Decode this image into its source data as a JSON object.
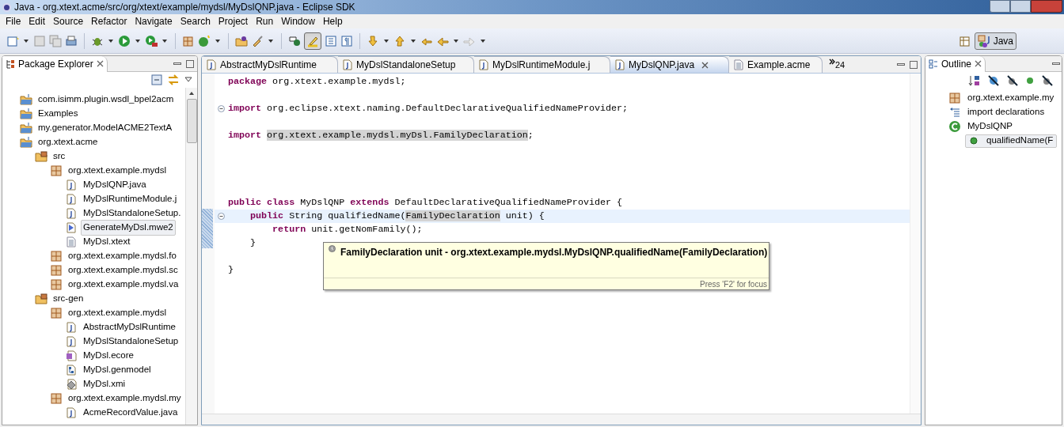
{
  "window": {
    "title": "Java - org.xtext.acme/src/org/xtext/example/mydsl/MyDslQNP.java - Eclipse SDK"
  },
  "menu": [
    "File",
    "Edit",
    "Source",
    "Refactor",
    "Navigate",
    "Search",
    "Project",
    "Run",
    "Window",
    "Help"
  ],
  "toolbar": {
    "mark_occurrences_on": true
  },
  "perspective": {
    "label": "Java",
    "selected": true
  },
  "package_explorer": {
    "title": "Package Explorer",
    "items": [
      {
        "kind": "project",
        "label": "com.isimm.plugin.wsdl_bpel2acm",
        "selected": false
      },
      {
        "kind": "project",
        "label": "Examples",
        "selected": false
      },
      {
        "kind": "project",
        "label": "my.generator.ModelACME2TextA",
        "selected": false
      },
      {
        "kind": "project",
        "label": "org.xtext.acme",
        "selected": false,
        "children": [
          {
            "kind": "folder",
            "label": "src",
            "selected": false,
            "children": [
              {
                "kind": "package",
                "label": "org.xtext.example.mydsl",
                "selected": false,
                "children": [
                  {
                    "kind": "java",
                    "label": "MyDslQNP.java",
                    "selected": false
                  },
                  {
                    "kind": "java",
                    "label": "MyDslRuntimeModule.j",
                    "selected": false
                  },
                  {
                    "kind": "java",
                    "label": "MyDslStandaloneSetup.",
                    "selected": false
                  },
                  {
                    "kind": "mwe2",
                    "label": "GenerateMyDsl.mwe2",
                    "selected": true
                  },
                  {
                    "kind": "xtext",
                    "label": "MyDsl.xtext",
                    "selected": false
                  }
                ]
              },
              {
                "kind": "package",
                "label": "org.xtext.example.mydsl.fo",
                "selected": false
              },
              {
                "kind": "package",
                "label": "org.xtext.example.mydsl.sc",
                "selected": false
              },
              {
                "kind": "package",
                "label": "org.xtext.example.mydsl.va",
                "selected": false
              }
            ]
          },
          {
            "kind": "folder",
            "label": "src-gen",
            "selected": false,
            "children": [
              {
                "kind": "package",
                "label": "org.xtext.example.mydsl",
                "selected": false,
                "children": [
                  {
                    "kind": "java",
                    "label": "AbstractMyDslRuntime",
                    "selected": false
                  },
                  {
                    "kind": "java",
                    "label": "MyDslStandaloneSetup",
                    "selected": false
                  },
                  {
                    "kind": "ecore",
                    "label": "MyDsl.ecore",
                    "selected": false
                  },
                  {
                    "kind": "genmodel",
                    "label": "MyDsl.genmodel",
                    "selected": false
                  },
                  {
                    "kind": "xmi",
                    "label": "MyDsl.xmi",
                    "selected": false
                  }
                ]
              },
              {
                "kind": "package",
                "label": "org.xtext.example.mydsl.my",
                "selected": false,
                "children": [
                  {
                    "kind": "java",
                    "label": "AcmeRecordValue.java",
                    "selected": false
                  }
                ]
              }
            ]
          }
        ]
      }
    ]
  },
  "editor_tabs": [
    {
      "kind": "java",
      "label": "AbstractMyDslRuntime",
      "selected": false
    },
    {
      "kind": "java",
      "label": "MyDslStandaloneSetup",
      "selected": false
    },
    {
      "kind": "java",
      "label": "MyDslRuntimeModule.j",
      "selected": false
    },
    {
      "kind": "java",
      "label": "MyDslQNP.java",
      "selected": true
    },
    {
      "kind": "text",
      "label": "Example.acme",
      "selected": false
    }
  ],
  "tab_overflow": "24",
  "code": [
    {
      "kind": "code",
      "segments": [
        {
          "kind": "keyword",
          "text": "package"
        },
        {
          "kind": "plain",
          "text": " org.xtext.example.mydsl;"
        }
      ]
    },
    {
      "kind": "blank"
    },
    {
      "kind": "code",
      "fold": true,
      "segments": [
        {
          "kind": "keyword",
          "text": "import"
        },
        {
          "kind": "plain",
          "text": " org.eclipse.xtext.naming.DefaultDeclarativeQualifiedNameProvider;"
        }
      ]
    },
    {
      "kind": "blank"
    },
    {
      "kind": "code",
      "segments": [
        {
          "kind": "keyword",
          "text": "import "
        },
        {
          "kind": "occurrence",
          "text": "org.xtext.example.mydsl.myDsl.FamilyDeclaration"
        },
        {
          "kind": "plain",
          "text": ";"
        }
      ]
    },
    {
      "kind": "blank"
    },
    {
      "kind": "blank"
    },
    {
      "kind": "blank"
    },
    {
      "kind": "blank"
    },
    {
      "kind": "code",
      "segments": [
        {
          "kind": "keyword",
          "text": "public class"
        },
        {
          "kind": "plain",
          "text": " MyDslQNP "
        },
        {
          "kind": "keyword",
          "text": "extends"
        },
        {
          "kind": "plain",
          "text": " DefaultDeclarativeQualifiedNameProvider {"
        }
      ]
    },
    {
      "kind": "code",
      "fold": true,
      "current": true,
      "segments": [
        {
          "kind": "keyword",
          "text": "    public"
        },
        {
          "kind": "plain",
          "text": " String qualifiedName("
        },
        {
          "kind": "occurrence",
          "text": "FamilyDeclaration"
        },
        {
          "kind": "plain",
          "text": " unit) {"
        }
      ]
    },
    {
      "kind": "code",
      "segments": [
        {
          "kind": "keyword",
          "text": "        return"
        },
        {
          "kind": "plain",
          "text": " unit.getNomFamily();"
        }
      ]
    },
    {
      "kind": "code",
      "segments": [
        {
          "kind": "plain",
          "text": "    }"
        }
      ]
    },
    {
      "kind": "blank"
    },
    {
      "kind": "code",
      "segments": [
        {
          "kind": "plain",
          "text": "}"
        }
      ]
    }
  ],
  "hover": {
    "text": "FamilyDeclaration unit - org.xtext.example.mydsl.MyDslQNP.qualifiedName(FamilyDeclaration)",
    "footer": "Press 'F2' for focus"
  },
  "outline": {
    "title": "Outline",
    "items": [
      {
        "kind": "package",
        "label": "org.xtext.example.my",
        "selected": false
      },
      {
        "kind": "imports",
        "label": "import declarations",
        "selected": false
      },
      {
        "kind": "class",
        "label": "MyDslQNP",
        "selected": false,
        "children": [
          {
            "kind": "method",
            "label": "qualifiedName(F",
            "selected": true
          }
        ]
      }
    ]
  }
}
